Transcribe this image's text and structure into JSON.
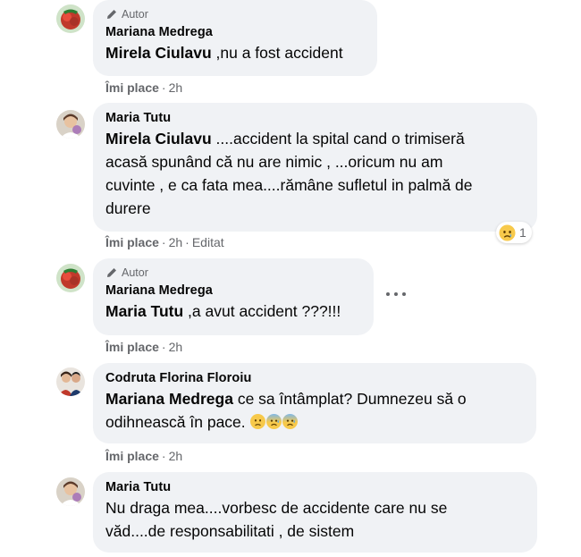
{
  "comments": [
    {
      "author_badge": "Autor",
      "name": "Mariana Medrega",
      "mention": "Mirela Ciulavu",
      "text": " ,nu a fost accident",
      "like_label": "Îmi place",
      "time": "2h"
    },
    {
      "name": "Maria Tutu",
      "mention": "Mirela Ciulavu",
      "text_line1": " ....accident la spital cand o trimiseră",
      "text_line2": "acasă spunând că nu are nimic , ...oricum nu am",
      "text_line3": "cuvinte , e ca fata mea....rămâne sufletul in palmă de",
      "text_line4": "durere",
      "like_label": "Îmi place",
      "time": "2h",
      "edited": "Editat",
      "reaction_count": "1",
      "reaction_icon": "sad-reaction-icon"
    },
    {
      "author_badge": "Autor",
      "name": "Mariana Medrega",
      "mention": "Maria Tutu",
      "text": " ,a avut accident ???!!!",
      "like_label": "Îmi place",
      "time": "2h"
    },
    {
      "name": "Codruta Florina Floroiu",
      "mention": "Mariana Medrega",
      "text_line1": " ce sa întâmplat? Dumnezeu să o",
      "text_line2": "odihnească în pace.",
      "like_label": "Îmi place",
      "time": "2h"
    },
    {
      "name": "Maria Tutu",
      "text_line1": "Nu draga mea....vorbesc de accidente care nu se",
      "text_line2": "văd....de responsabilitati , de sistem"
    }
  ],
  "colors": {
    "bubble": "#f0f2f5",
    "secondary_text": "#65676b",
    "primary_text": "#050505"
  }
}
